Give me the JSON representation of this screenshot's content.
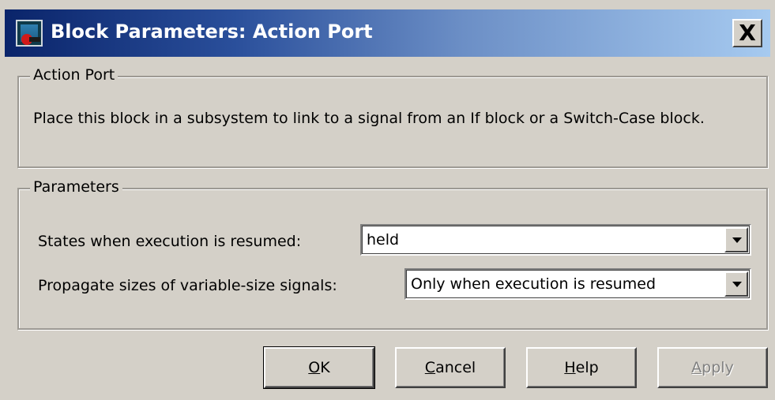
{
  "dialog": {
    "title": "Block Parameters: Action Port",
    "close_glyph": "X"
  },
  "action_port_group": {
    "legend": "Action Port",
    "description": "Place this block in a subsystem to link to a signal from an If block or a Switch-Case block."
  },
  "parameters_group": {
    "legend": "Parameters",
    "states_label": "States when execution is resumed:",
    "states_value": "held",
    "propagate_label": "Propagate sizes of variable-size signals:",
    "propagate_value": "Only when execution is resumed"
  },
  "buttons": {
    "ok": {
      "mnemonic": "O",
      "rest": "K"
    },
    "cancel": {
      "mnemonic": "C",
      "rest": "ancel"
    },
    "help": {
      "mnemonic": "H",
      "rest": "elp"
    },
    "apply": {
      "mnemonic": "A",
      "rest": "pply",
      "enabled": false
    }
  },
  "icons": {
    "window_icon": "simulink-block-icon",
    "close_icon": "close-icon",
    "dropdown_icon": "chevron-down-icon"
  },
  "colors": {
    "titlebar_start": "#0a246a",
    "titlebar_end": "#a6caf0",
    "face": "#d4d0c8",
    "disabled_text": "#808080"
  }
}
